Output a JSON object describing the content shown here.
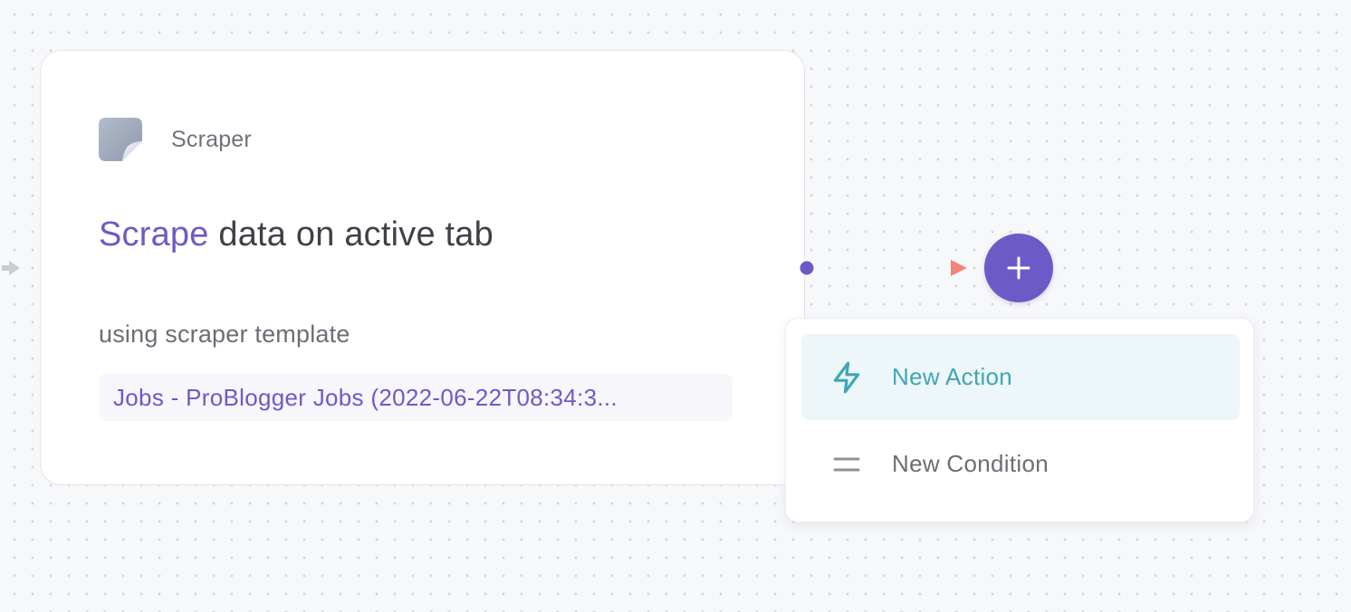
{
  "node": {
    "app_name": "Scraper",
    "app_icon": "scraper-sticker-icon",
    "title_verb": "Scrape",
    "title_rest": "data on active tab",
    "param_label": "using scraper template",
    "param_value": "Jobs - ProBlogger Jobs (2022-06-22T08:34:3..."
  },
  "connector": {
    "add_button_icon": "plus-icon"
  },
  "add_menu": {
    "items": [
      {
        "label": "New Action",
        "icon": "lightning-bolt-icon"
      },
      {
        "label": "New Condition",
        "icon": "equals-icon"
      }
    ]
  },
  "colors": {
    "accent_purple": "#6c5bc6",
    "accent_teal": "#3ea6b6",
    "connector_end": "#f0857a",
    "highlight_bg": "#edf6f8"
  }
}
